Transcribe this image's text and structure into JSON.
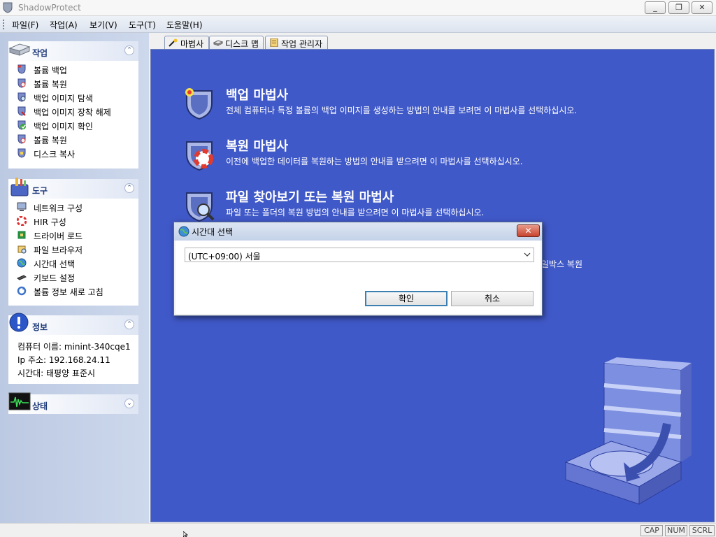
{
  "window": {
    "title": "ShadowProtect",
    "min": "_",
    "max": "❐",
    "close": "✕"
  },
  "menu": [
    "파일(F)",
    "작업(A)",
    "보기(V)",
    "도구(T)",
    "도움말(H)"
  ],
  "tasks_panel": {
    "title": "작업",
    "items": [
      "볼륨 백업",
      "볼륨 복원",
      "백업 이미지 탐색",
      "백업 이미지 장착 해제",
      "백업 이미지 확인",
      "볼륨 복원",
      "디스크 복사"
    ]
  },
  "tools_panel": {
    "title": "도구",
    "items": [
      "네트워크 구성",
      "HIR 구성",
      "드라이버 로드",
      "파일 브라우저",
      "시간대 선택",
      "키보드 설정",
      "볼륨 정보 새로 고침"
    ]
  },
  "info_panel": {
    "title": "정보",
    "computer_name": "컴퓨터 이름: minint-340cqe1",
    "ip": "Ip 주소: 192.168.24.11",
    "timezone": "시간대: 태평양 표준시"
  },
  "status_panel": {
    "title": "상태"
  },
  "tabs": [
    "마법사",
    "디스크 맵",
    "작업 관리자"
  ],
  "wizards": [
    {
      "title": "백업 마법사",
      "desc": "전체 컴퓨터나 특정 볼륨의 백업 이미지를 생성하는 방법의 안내를 보려면 이 마법사를 선택하십시오."
    },
    {
      "title": "복원 마법사",
      "desc": "이전에 백업한 데이터를 복원하는 방법의 안내를 받으려면 이 마법사를 선택하십시오."
    },
    {
      "title": "파일 찾아보기 또는 복원 마법사",
      "desc": "파일 또는 폴더의 복원 방법의 안내를 받으려면 이 마법사를 선택하십시오."
    }
  ],
  "partial_wizard_text": "일박스 복원",
  "dialog": {
    "title": "시간대 선택",
    "close": "✕",
    "selected_timezone": "(UTC+09:00) 서울",
    "ok": "확인",
    "cancel": "취소"
  },
  "status_bar": [
    "CAP",
    "NUM",
    "SCRL"
  ],
  "colors": {
    "main_bg": "#4059c8",
    "sidebar_bg": "#c5d1ea",
    "panel_title": "#1e3a7a"
  }
}
